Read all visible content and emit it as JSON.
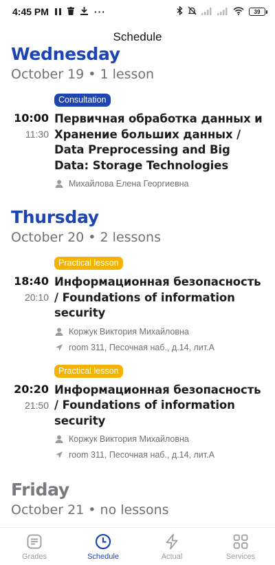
{
  "status_bar": {
    "time": "4:45 PM",
    "more": "···",
    "battery": "39"
  },
  "header": {
    "title": "Schedule"
  },
  "days": [
    {
      "name": "Wednesday",
      "subtitle": "October 19 • 1 lesson",
      "lessons": [
        {
          "type": "Consultation",
          "start": "10:00",
          "end": "11:30",
          "title": "Первичная обработка данных и Хранение больших данных / Data Preprocessing and Big Data: Storage Technologies",
          "teacher": "Михайлова Елена Георгиевна"
        }
      ]
    },
    {
      "name": "Thursday",
      "subtitle": "October 20 • 2 lessons",
      "lessons": [
        {
          "type": "Practical lesson",
          "start": "18:40",
          "end": "20:10",
          "title": "Информационная безопасность / Foundations of information security",
          "teacher": "Коржук Виктория Михайловна",
          "location": "room 311, Песочная наб., д.14, лит.А"
        },
        {
          "type": "Practical lesson",
          "start": "20:20",
          "end": "21:50",
          "title": "Информационная безопасность / Foundations of information security",
          "teacher": "Коржук Виктория Михайловна",
          "location": "room 311, Песочная наб., д.14, лит.А"
        }
      ]
    },
    {
      "name": "Friday",
      "subtitle": "October 21 • no lessons",
      "lessons": []
    }
  ],
  "nav": {
    "items": [
      {
        "label": "Grades",
        "icon": "grades-icon"
      },
      {
        "label": "Schedule",
        "icon": "clock-icon",
        "active": true
      },
      {
        "label": "Actual",
        "icon": "lightning-icon"
      },
      {
        "label": "Services",
        "icon": "grid-icon"
      }
    ]
  },
  "colors": {
    "accent": "#1d44b3",
    "practical_badge": "#f3b300",
    "muted_text": "#6f6f74"
  }
}
